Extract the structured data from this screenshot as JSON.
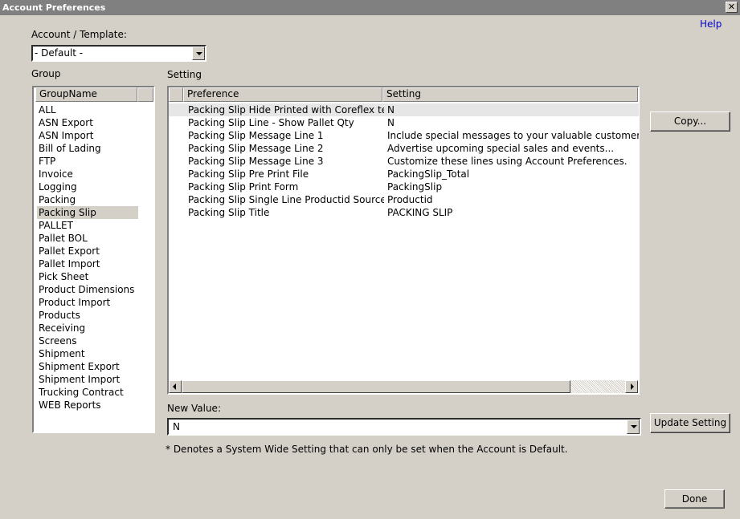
{
  "window": {
    "title": "Account Preferences",
    "close_glyph": "✕"
  },
  "help_link": "Help",
  "account_template": {
    "label": "Account / Template:",
    "value": "- Default -"
  },
  "group": {
    "label": "Group",
    "column_header": "GroupName",
    "items": [
      "ALL",
      "ASN Export",
      "ASN Import",
      "Bill of Lading",
      "FTP",
      "Invoice",
      "Logging",
      "Packing",
      "Packing Slip",
      "PALLET",
      "Pallet BOL",
      "Pallet Export",
      "Pallet Import",
      "Pick Sheet",
      "Product Dimensions",
      "Product Import",
      "Products",
      "Receiving",
      "Screens",
      "Shipment",
      "Shipment Export",
      "Shipment Import",
      "Trucking Contract",
      "WEB Reports"
    ],
    "selected": "Packing Slip"
  },
  "setting": {
    "label": "Setting",
    "columns": {
      "preference": "Preference",
      "setting": "Setting"
    },
    "rows": [
      {
        "preference": "Packing Slip Hide Printed with Coreflex text",
        "setting": "N"
      },
      {
        "preference": "Packing Slip Line - Show Pallet Qty",
        "setting": "N"
      },
      {
        "preference": "Packing Slip Message Line 1",
        "setting": "Include special messages to your valuable customers he"
      },
      {
        "preference": "Packing Slip Message Line 2",
        "setting": "Advertise upcoming special sales and events..."
      },
      {
        "preference": "Packing Slip Message Line 3",
        "setting": "Customize these lines using Account Preferences."
      },
      {
        "preference": "Packing Slip Pre Print File",
        "setting": "PackingSlip_Total"
      },
      {
        "preference": "Packing Slip Print Form",
        "setting": "PackingSlip"
      },
      {
        "preference": "Packing Slip Single Line Productid Source",
        "setting": "Productid"
      },
      {
        "preference": "Packing Slip Title",
        "setting": "PACKING SLIP"
      }
    ],
    "selected_row": 0
  },
  "buttons": {
    "copy": "Copy...",
    "update": "Update Setting",
    "done": "Done"
  },
  "new_value": {
    "label": "New Value:",
    "value": "N"
  },
  "footnote": "* Denotes a System Wide Setting that can only be set when the Account is Default."
}
